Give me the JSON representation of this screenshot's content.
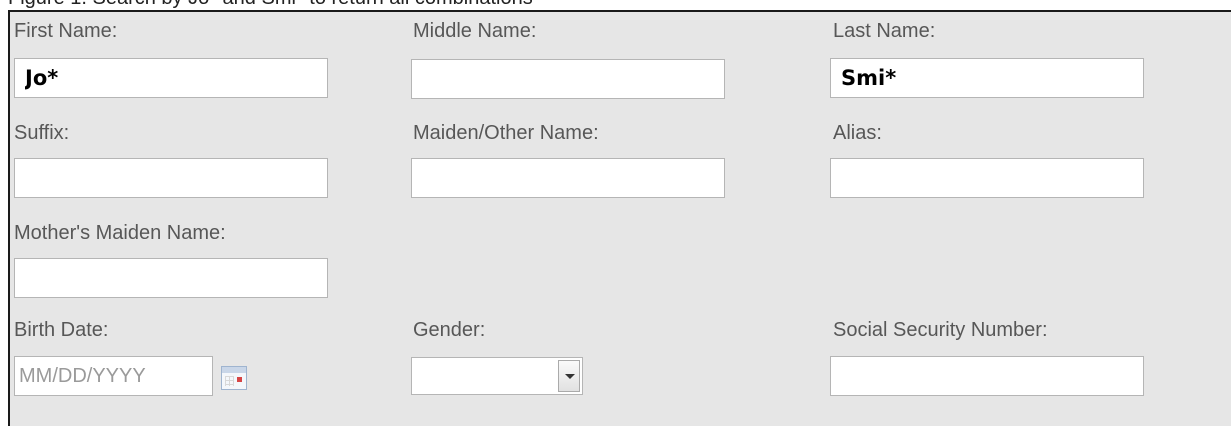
{
  "caption": "Figure 1. Search by Jo* and Smi* to return all combinations",
  "form": {
    "first_name": {
      "label": "First Name:",
      "value": "Jo*"
    },
    "middle_name": {
      "label": "Middle Name:",
      "value": ""
    },
    "last_name": {
      "label": "Last Name:",
      "value": "Smi*"
    },
    "suffix": {
      "label": "Suffix:",
      "value": ""
    },
    "maiden_other": {
      "label": "Maiden/Other Name:",
      "value": ""
    },
    "alias": {
      "label": "Alias:",
      "value": ""
    },
    "mothers_maiden": {
      "label": "Mother's Maiden Name:",
      "value": ""
    },
    "birth_date": {
      "label": "Birth Date:",
      "value": "",
      "placeholder": "MM/DD/YYYY"
    },
    "gender": {
      "label": "Gender:",
      "selected": ""
    },
    "ssn": {
      "label": "Social Security Number:",
      "value": ""
    }
  },
  "icons": {
    "calendar": "calendar-icon",
    "dropdown": "chevron-down-icon"
  }
}
